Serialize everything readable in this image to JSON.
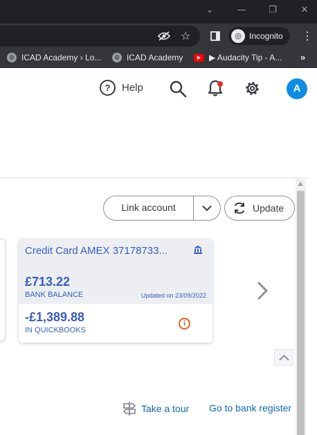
{
  "browser": {
    "bookmarks": [
      {
        "label": "ICAD Academy › Lo...",
        "icon": "globe-icon"
      },
      {
        "label": "ICAD Academy",
        "icon": "globe-icon"
      },
      {
        "label": "▶ Audacity Tip - A...",
        "icon": "youtube-icon"
      }
    ],
    "bookmarks_more": "»",
    "incognito_label": "Incognito"
  },
  "header": {
    "help_label": "Help",
    "avatar_initial": "A"
  },
  "actions": {
    "link_account_label": "Link account",
    "update_label": "Update"
  },
  "card": {
    "title": "Credit Card AMEX 37178733...",
    "bank_balance": "£713.22",
    "bank_balance_label": "BANK BALANCE",
    "updated_text": "Updated on 23/09/2022",
    "qb_balance": "-£1,389.88",
    "qb_label": "IN QUICKBOOKS"
  },
  "footer": {
    "take_tour": "Take a tour",
    "bank_register": "Go to bank register"
  },
  "colors": {
    "brand_blue": "#365ebf",
    "link_blue": "#0d67b5",
    "avatar_blue": "#0d8ce4",
    "warning_orange": "#e66121",
    "notification_red": "#e32d2d"
  }
}
